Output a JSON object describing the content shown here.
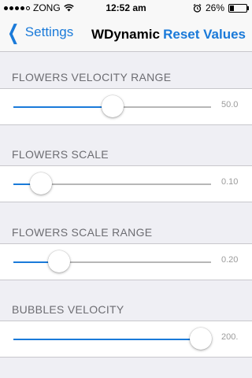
{
  "status_bar": {
    "carrier": "ZONG",
    "time": "12:52 am",
    "battery": "26%",
    "battery_level": 0.26
  },
  "nav": {
    "back_label": "Settings",
    "title": "WDynamic",
    "reset_label": "Reset Values"
  },
  "sliders": [
    {
      "label": "FLOWERS VELOCITY RANGE",
      "value": "50.0",
      "position": 0.5
    },
    {
      "label": "FLOWERS SCALE",
      "value": "0.10",
      "position": 0.14
    },
    {
      "label": "FLOWERS SCALE RANGE",
      "value": "0.20",
      "position": 0.23
    },
    {
      "label": "BUBBLES VELOCITY",
      "value": "200.",
      "position": 0.95
    }
  ],
  "colors": {
    "accent": "#1a7ad9",
    "background": "#efeff4"
  }
}
